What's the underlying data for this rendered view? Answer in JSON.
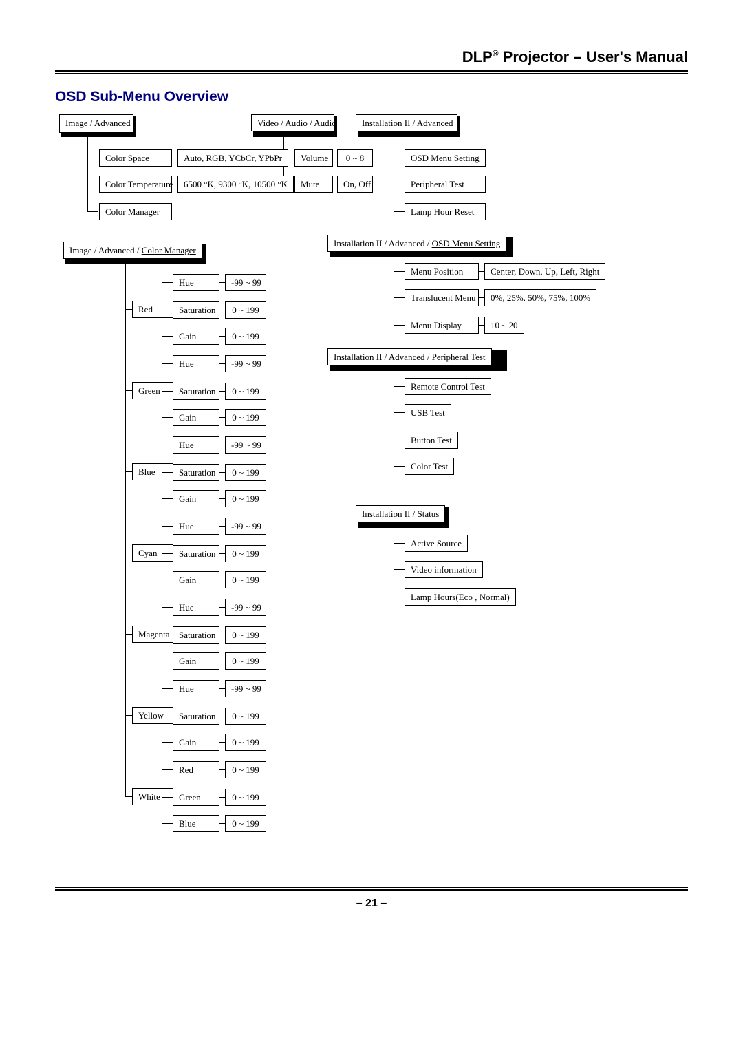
{
  "header": {
    "pre": "DLP",
    "sup": "®",
    "post": " Projector – User's Manual"
  },
  "section_title": "OSD Sub-Menu Overview",
  "page_number": "– 21 –",
  "hdr": {
    "image_adv": "Image / ",
    "image_adv_u": "Advanced",
    "video_audio": "Video / Audio / ",
    "video_audio_u": "Audio",
    "inst2_adv": "Installation II / ",
    "inst2_adv_u": "Advanced",
    "image_adv_cm": "Image / Advanced / ",
    "image_adv_cm_u": "Color Manager",
    "inst2_osd": "Installation II / Advanced / ",
    "inst2_osd_u": "OSD Menu Setting",
    "inst2_per": "Installation II / Advanced / ",
    "inst2_per_u": "Peripheral Test",
    "inst2_status": "Installation II / ",
    "inst2_status_u": "Status"
  },
  "n": {
    "color_space": "Color Space",
    "color_space_v": "Auto, RGB, YCbCr, YPbPr",
    "color_temp": "Color Temperature",
    "color_temp_v": "6500 °K, 9300 °K, 10500 °K",
    "color_manager": "Color Manager",
    "volume": "Volume",
    "volume_v": "0 ~ 8",
    "mute": "Mute",
    "mute_v": "On, Off",
    "osd_menu": "OSD Menu Setting",
    "periph": "Peripheral Test",
    "lamp_reset": "Lamp Hour Reset",
    "hue": "Hue",
    "sat": "Saturation",
    "gain": "Gain",
    "r_hue_v": "-99 ~ 99",
    "r_sat_v": "0 ~ 199",
    "r_gain_v": "0 ~ 199",
    "red": "Red",
    "green": "Green",
    "blue": "Blue",
    "cyan": "Cyan",
    "magenta": "Magenta",
    "yellow": "Yellow",
    "white": "White",
    "white_r": "Red",
    "white_g": "Green",
    "white_b": "Blue",
    "menu_pos": "Menu Position",
    "menu_pos_v": "Center, Down, Up, Left, Right",
    "trans_menu": "Translucent Menu",
    "trans_menu_v": "0%, 25%, 50%, 75%, 100%",
    "menu_disp": "Menu Display",
    "menu_disp_v": "10 ~ 20",
    "remote_test": "Remote Control Test",
    "usb_test": "USB Test",
    "button_test": "Button Test",
    "color_test": "Color Test",
    "active_src": "Active Source",
    "video_info": "Video information",
    "lamp_hours": "Lamp Hours(Eco , Normal)"
  }
}
